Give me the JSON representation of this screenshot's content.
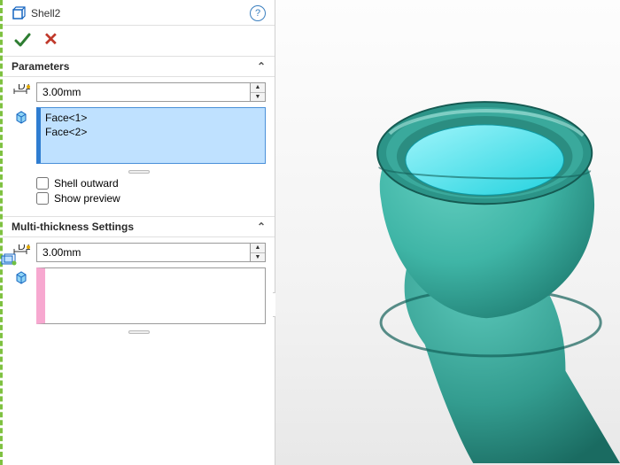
{
  "header": {
    "title": "Shell2",
    "help_tooltip": "?"
  },
  "actions": {
    "ok_label": "OK",
    "cancel_label": "Cancel"
  },
  "sections": {
    "parameters": {
      "title": "Parameters",
      "thickness_value": "3.00mm",
      "faces": [
        "Face<1>",
        "Face<2>"
      ],
      "shell_outward_label": "Shell outward",
      "shell_outward_checked": false,
      "show_preview_label": "Show preview",
      "show_preview_checked": false
    },
    "multi_thickness": {
      "title": "Multi-thickness Settings",
      "thickness_value": "3.00mm",
      "faces": []
    }
  },
  "icons": {
    "feature": "shell-feature",
    "dimension": "dimension",
    "selection_cube": "cube"
  },
  "colors": {
    "accent_green": "#2e7d32",
    "accent_red": "#c0392b",
    "selection_blue": "#bfe1ff",
    "model_body": "#3fb5a6",
    "model_face": "#35e0ea"
  }
}
